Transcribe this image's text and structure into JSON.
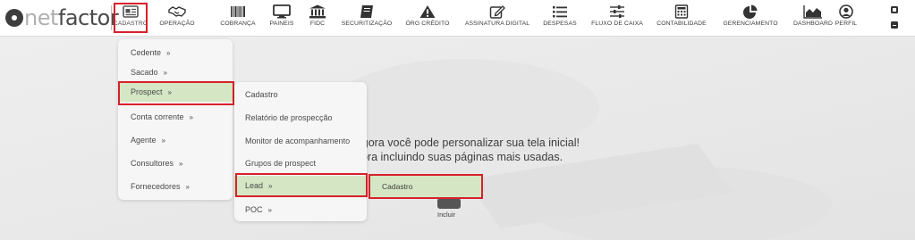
{
  "app": {
    "logo_net": "net",
    "logo_factor": "factor"
  },
  "nav": {
    "items": [
      {
        "label": "CADASTRO",
        "icon": "id-card-icon",
        "active": true
      },
      {
        "label": "OPERAÇÃO",
        "icon": "handshake-icon"
      },
      {
        "label": "COBRANÇA",
        "icon": "barcode-icon"
      },
      {
        "label": "PAINEIS",
        "icon": "monitor-icon"
      },
      {
        "label": "FIDC",
        "icon": "bank-icon"
      },
      {
        "label": "SECURITIZAÇÃO",
        "icon": "notebook-icon"
      },
      {
        "label": "ÓRG CRÉDITO",
        "icon": "warning-icon"
      },
      {
        "label": "ASSINATURA DIGITAL",
        "icon": "pen-edit-icon"
      },
      {
        "label": "DESPESAS",
        "icon": "list-icon"
      },
      {
        "label": "FLUXO DE CAIXA",
        "icon": "sliders-icon"
      },
      {
        "label": "CONTABILIDADE",
        "icon": "calculator-icon"
      },
      {
        "label": "GERENCIAMENTO",
        "icon": "pie-chart-icon"
      },
      {
        "label": "DASHBOARD",
        "icon": "area-chart-icon"
      },
      {
        "label": "PERFIL",
        "icon": "user-icon"
      }
    ],
    "window_controls": [
      "maximize-icon",
      "minimize-icon"
    ]
  },
  "menu_cadastro": {
    "items": [
      {
        "label": "Cedente"
      },
      {
        "label": "Sacado"
      },
      {
        "label": "Prospect",
        "selected": true
      },
      {
        "label": "Conta corrente"
      },
      {
        "label": "Agente"
      },
      {
        "label": "Consultores"
      },
      {
        "label": "Fornecedores"
      }
    ],
    "chevron": "»"
  },
  "menu_prospect": {
    "items": [
      {
        "label": "Cadastro"
      },
      {
        "label": "Relatório de prospecção"
      },
      {
        "label": "Monitor de acompanhamento"
      },
      {
        "label": "Grupos de prospect"
      },
      {
        "label": "Lead",
        "selected": true,
        "chevron": "»"
      },
      {
        "label": "POC",
        "chevron": "»"
      }
    ]
  },
  "menu_lead": {
    "items": [
      {
        "label": "Cadastro",
        "selected": true
      }
    ]
  },
  "welcome": {
    "line1": "ou e agora você pode personalizar sua tela inicial!",
    "line2": "gora incluindo suas páginas mais usadas."
  },
  "incluir": {
    "label": "Incluir"
  },
  "colors": {
    "highlight_red": "#d7212a",
    "selected_green": "#d4e6c4",
    "icon_dark": "#3a3a3a"
  }
}
